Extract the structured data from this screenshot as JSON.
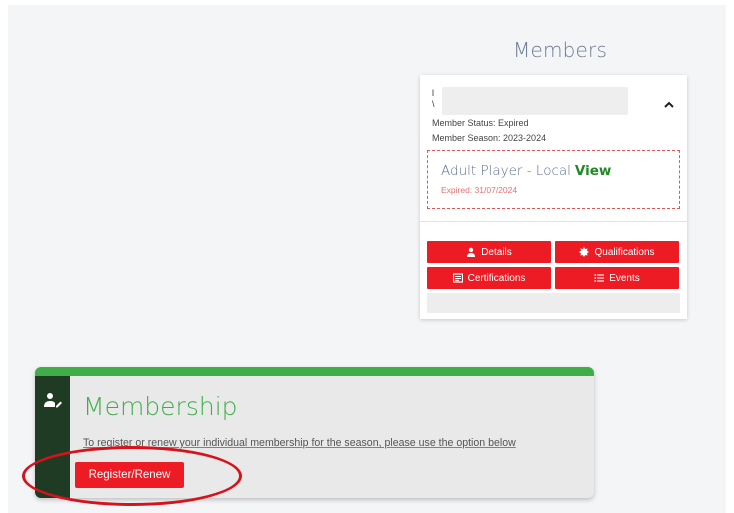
{
  "members": {
    "heading": "Members",
    "card": {
      "name_line1": "l",
      "name_line2": "\\",
      "status": "Member Status: Expired",
      "season": "Member Season: 2023-2024",
      "plan": {
        "name": "Adult Player - Local",
        "view_label": "View",
        "expired": "Expired: 31/07/2024"
      },
      "buttons": {
        "details": "Details",
        "qualifications": "Qualifications",
        "certifications": "Certifications",
        "events": "Events"
      }
    }
  },
  "membership": {
    "title": "Membership",
    "description": "To register or renew your individual membership for the season, please use the option below",
    "register_label": "Register/Renew"
  },
  "colors": {
    "accent_red": "#ed1c24",
    "accent_green": "#3fae49",
    "sidebar_dark": "#1f3b24",
    "annotation": "#d4131c"
  }
}
